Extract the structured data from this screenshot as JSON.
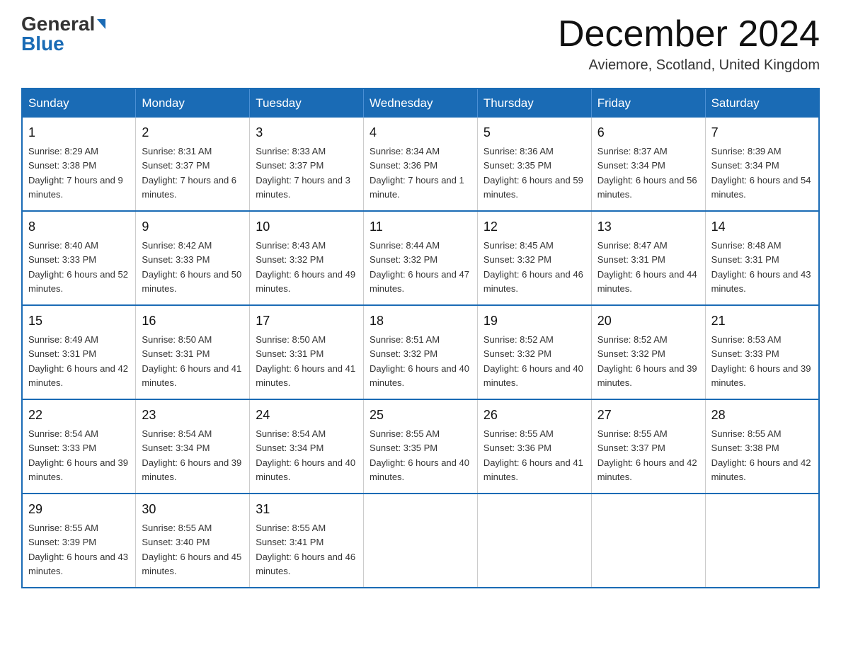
{
  "header": {
    "logo_general": "General",
    "logo_blue": "Blue",
    "month_title": "December 2024",
    "location": "Aviemore, Scotland, United Kingdom"
  },
  "weekdays": [
    "Sunday",
    "Monday",
    "Tuesday",
    "Wednesday",
    "Thursday",
    "Friday",
    "Saturday"
  ],
  "weeks": [
    [
      {
        "day": "1",
        "sunrise": "8:29 AM",
        "sunset": "3:38 PM",
        "daylight": "7 hours and 9 minutes."
      },
      {
        "day": "2",
        "sunrise": "8:31 AM",
        "sunset": "3:37 PM",
        "daylight": "7 hours and 6 minutes."
      },
      {
        "day": "3",
        "sunrise": "8:33 AM",
        "sunset": "3:37 PM",
        "daylight": "7 hours and 3 minutes."
      },
      {
        "day": "4",
        "sunrise": "8:34 AM",
        "sunset": "3:36 PM",
        "daylight": "7 hours and 1 minute."
      },
      {
        "day": "5",
        "sunrise": "8:36 AM",
        "sunset": "3:35 PM",
        "daylight": "6 hours and 59 minutes."
      },
      {
        "day": "6",
        "sunrise": "8:37 AM",
        "sunset": "3:34 PM",
        "daylight": "6 hours and 56 minutes."
      },
      {
        "day": "7",
        "sunrise": "8:39 AM",
        "sunset": "3:34 PM",
        "daylight": "6 hours and 54 minutes."
      }
    ],
    [
      {
        "day": "8",
        "sunrise": "8:40 AM",
        "sunset": "3:33 PM",
        "daylight": "6 hours and 52 minutes."
      },
      {
        "day": "9",
        "sunrise": "8:42 AM",
        "sunset": "3:33 PM",
        "daylight": "6 hours and 50 minutes."
      },
      {
        "day": "10",
        "sunrise": "8:43 AM",
        "sunset": "3:32 PM",
        "daylight": "6 hours and 49 minutes."
      },
      {
        "day": "11",
        "sunrise": "8:44 AM",
        "sunset": "3:32 PM",
        "daylight": "6 hours and 47 minutes."
      },
      {
        "day": "12",
        "sunrise": "8:45 AM",
        "sunset": "3:32 PM",
        "daylight": "6 hours and 46 minutes."
      },
      {
        "day": "13",
        "sunrise": "8:47 AM",
        "sunset": "3:31 PM",
        "daylight": "6 hours and 44 minutes."
      },
      {
        "day": "14",
        "sunrise": "8:48 AM",
        "sunset": "3:31 PM",
        "daylight": "6 hours and 43 minutes."
      }
    ],
    [
      {
        "day": "15",
        "sunrise": "8:49 AM",
        "sunset": "3:31 PM",
        "daylight": "6 hours and 42 minutes."
      },
      {
        "day": "16",
        "sunrise": "8:50 AM",
        "sunset": "3:31 PM",
        "daylight": "6 hours and 41 minutes."
      },
      {
        "day": "17",
        "sunrise": "8:50 AM",
        "sunset": "3:31 PM",
        "daylight": "6 hours and 41 minutes."
      },
      {
        "day": "18",
        "sunrise": "8:51 AM",
        "sunset": "3:32 PM",
        "daylight": "6 hours and 40 minutes."
      },
      {
        "day": "19",
        "sunrise": "8:52 AM",
        "sunset": "3:32 PM",
        "daylight": "6 hours and 40 minutes."
      },
      {
        "day": "20",
        "sunrise": "8:52 AM",
        "sunset": "3:32 PM",
        "daylight": "6 hours and 39 minutes."
      },
      {
        "day": "21",
        "sunrise": "8:53 AM",
        "sunset": "3:33 PM",
        "daylight": "6 hours and 39 minutes."
      }
    ],
    [
      {
        "day": "22",
        "sunrise": "8:54 AM",
        "sunset": "3:33 PM",
        "daylight": "6 hours and 39 minutes."
      },
      {
        "day": "23",
        "sunrise": "8:54 AM",
        "sunset": "3:34 PM",
        "daylight": "6 hours and 39 minutes."
      },
      {
        "day": "24",
        "sunrise": "8:54 AM",
        "sunset": "3:34 PM",
        "daylight": "6 hours and 40 minutes."
      },
      {
        "day": "25",
        "sunrise": "8:55 AM",
        "sunset": "3:35 PM",
        "daylight": "6 hours and 40 minutes."
      },
      {
        "day": "26",
        "sunrise": "8:55 AM",
        "sunset": "3:36 PM",
        "daylight": "6 hours and 41 minutes."
      },
      {
        "day": "27",
        "sunrise": "8:55 AM",
        "sunset": "3:37 PM",
        "daylight": "6 hours and 42 minutes."
      },
      {
        "day": "28",
        "sunrise": "8:55 AM",
        "sunset": "3:38 PM",
        "daylight": "6 hours and 42 minutes."
      }
    ],
    [
      {
        "day": "29",
        "sunrise": "8:55 AM",
        "sunset": "3:39 PM",
        "daylight": "6 hours and 43 minutes."
      },
      {
        "day": "30",
        "sunrise": "8:55 AM",
        "sunset": "3:40 PM",
        "daylight": "6 hours and 45 minutes."
      },
      {
        "day": "31",
        "sunrise": "8:55 AM",
        "sunset": "3:41 PM",
        "daylight": "6 hours and 46 minutes."
      },
      null,
      null,
      null,
      null
    ]
  ]
}
